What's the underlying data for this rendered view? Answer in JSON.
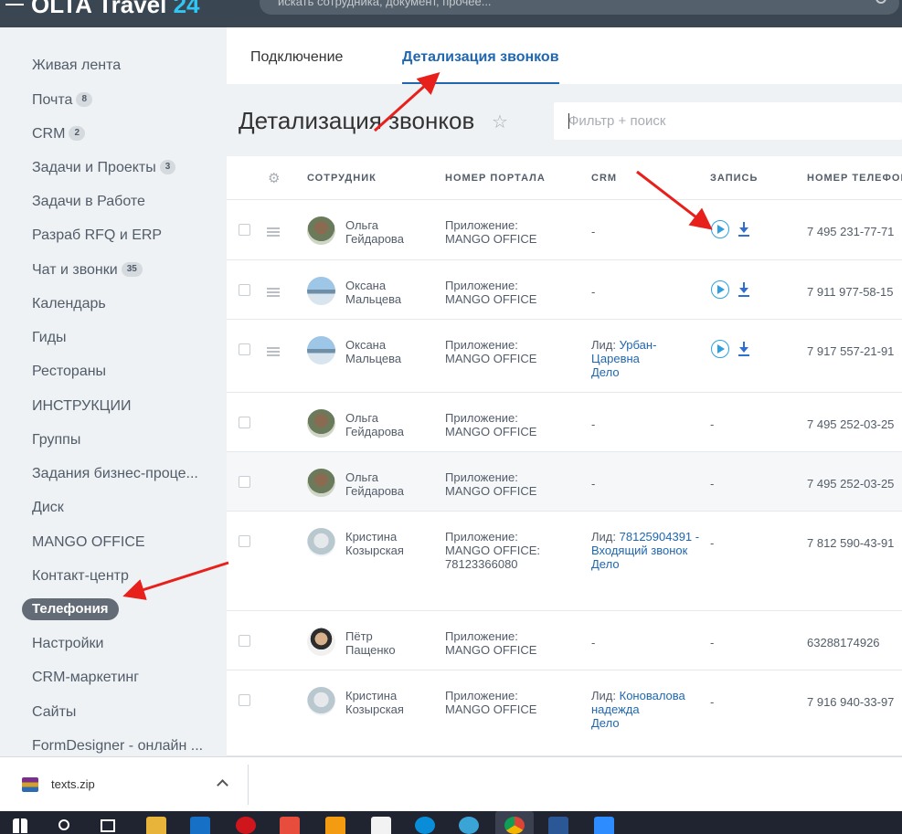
{
  "header": {
    "logo_text": "OLTA Travel",
    "logo_suffix": "24",
    "search_placeholder": "искать сотрудника, документ, прочее..."
  },
  "sidebar": {
    "items": [
      {
        "label": "Живая лента",
        "count": ""
      },
      {
        "label": "Почта",
        "count": "8"
      },
      {
        "label": "CRM",
        "count": "2"
      },
      {
        "label": "Задачи и Проекты",
        "count": "3"
      },
      {
        "label": "Задачи в Работе",
        "count": ""
      },
      {
        "label": "Разраб RFQ и ERP",
        "count": ""
      },
      {
        "label": "Чат и звонки",
        "count": "35"
      },
      {
        "label": "Календарь",
        "count": ""
      },
      {
        "label": "Гиды",
        "count": ""
      },
      {
        "label": "Рестораны",
        "count": ""
      },
      {
        "label": "ИНСТРУКЦИИ",
        "count": ""
      },
      {
        "label": "Группы",
        "count": ""
      },
      {
        "label": "Задания бизнес-проце...",
        "count": ""
      },
      {
        "label": "Диск",
        "count": ""
      },
      {
        "label": "MANGO OFFICE",
        "count": ""
      },
      {
        "label": "Контакт-центр",
        "count": ""
      },
      {
        "label": "Телефония",
        "count": "",
        "active": true
      },
      {
        "label": "Настройки",
        "count": ""
      },
      {
        "label": "CRM-маркетинг",
        "count": ""
      },
      {
        "label": "Сайты",
        "count": ""
      },
      {
        "label": "FormDesigner - онлайн ...",
        "count": ""
      }
    ]
  },
  "tabs": [
    {
      "label": "Подключение"
    },
    {
      "label": "Детализация звонков",
      "active": true
    }
  ],
  "page_title": "Детализация звонков",
  "filter_placeholder": "Фильтр + поиск",
  "grid": {
    "columns": [
      "СОТРУДНИК",
      "НОМЕР ПОРТАЛА",
      "CRM",
      "ЗАПИСЬ",
      "НОМЕР ТЕЛЕФОНА"
    ],
    "rows": [
      {
        "employee": [
          "Ольга",
          "Гейдарова"
        ],
        "portal": [
          "Приложение:",
          "MANGO OFFICE"
        ],
        "crm_prefix": "",
        "crm_link": "",
        "crm_text": "-",
        "record": true,
        "phone": "7 495 231-77-71",
        "menu": true
      },
      {
        "employee": [
          "Оксана",
          "Мальцева"
        ],
        "portal": [
          "Приложение:",
          "MANGO OFFICE"
        ],
        "crm_prefix": "",
        "crm_link": "",
        "crm_text": "-",
        "record": true,
        "phone": "7 911 977-58-15",
        "menu": true
      },
      {
        "employee": [
          "Оксана",
          "Мальцева"
        ],
        "portal": [
          "Приложение:",
          "MANGO OFFICE"
        ],
        "crm_prefix": "Лид:",
        "crm_link": "Урбан-Царевна",
        "crm_text": "Дело",
        "record": true,
        "phone": "7 917 557-21-91",
        "menu": true
      },
      {
        "employee": [
          "Ольга",
          "Гейдарова"
        ],
        "portal": [
          "Приложение:",
          "MANGO OFFICE"
        ],
        "crm_prefix": "",
        "crm_link": "",
        "crm_text": "-",
        "record": false,
        "record_text": "-",
        "phone": "7 495 252-03-25",
        "menu": false
      },
      {
        "employee": [
          "Ольга",
          "Гейдарова"
        ],
        "portal": [
          "Приложение:",
          "MANGO OFFICE"
        ],
        "crm_prefix": "",
        "crm_link": "",
        "crm_text": "-",
        "record": false,
        "record_text": "-",
        "phone": "7 495 252-03-25",
        "menu": false
      },
      {
        "employee": [
          "Кристина",
          "Козырская"
        ],
        "portal": [
          "Приложение:",
          "MANGO OFFICE:",
          "78123366080"
        ],
        "crm_prefix": "Лид:",
        "crm_link": "78125904391 - Входящий звонок",
        "crm_text": "Дело",
        "record": false,
        "record_text": "-",
        "phone": "7 812 590-43-91",
        "menu": false
      },
      {
        "employee": [
          "Пётр",
          "Пащенко"
        ],
        "portal": [
          "Приложение:",
          "MANGO OFFICE"
        ],
        "crm_prefix": "",
        "crm_link": "",
        "crm_text": "-",
        "record": false,
        "record_text": "-",
        "phone": "63288174926",
        "menu": false
      },
      {
        "employee": [
          "Кристина",
          "Козырская"
        ],
        "portal": [
          "Приложение:",
          "MANGO OFFICE"
        ],
        "crm_prefix": "Лид:",
        "crm_link": "Коновалова надежда",
        "crm_text": "Дело",
        "record": false,
        "record_text": "-",
        "phone": "7 916 940-33-97",
        "menu": false
      }
    ]
  },
  "download_bar": {
    "file_name": "texts.zip"
  },
  "colors": {
    "accent": "#2067b0",
    "header": "#3a4753",
    "arrow": "#e8201c"
  }
}
